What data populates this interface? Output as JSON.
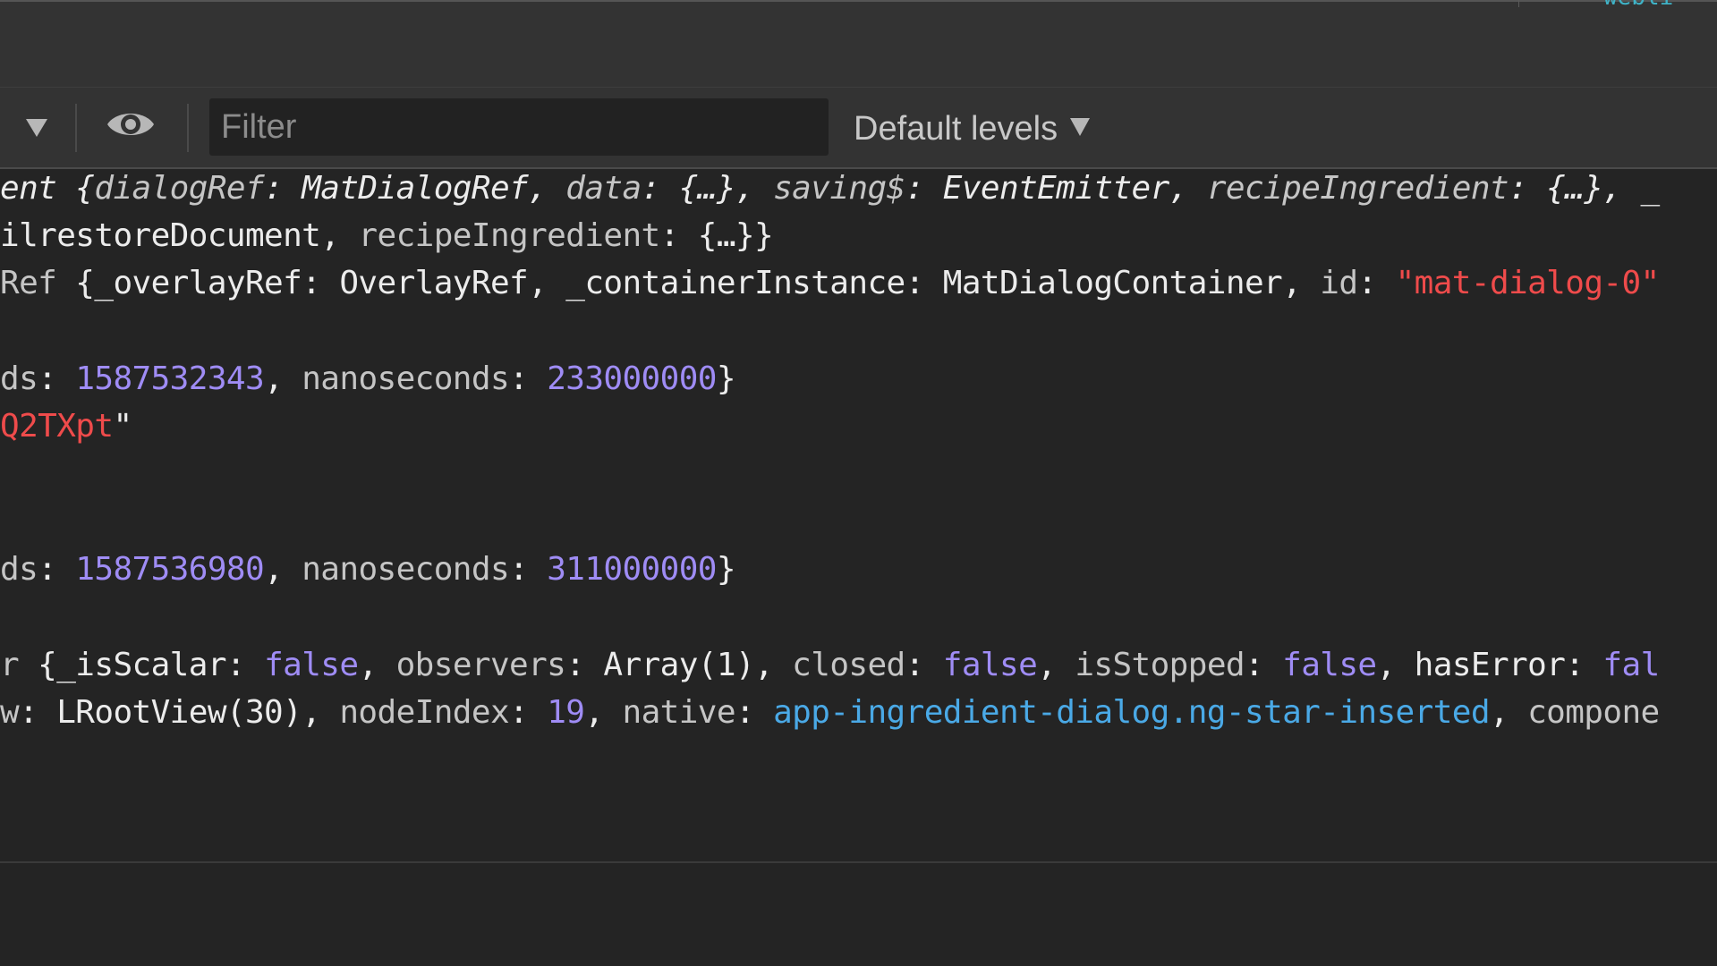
{
  "top_bar": {
    "corner_text": "webli"
  },
  "toolbar": {
    "filter_placeholder": "Filter",
    "levels_label": "Default levels"
  },
  "icons": {
    "dropdown": "triangle-down-icon",
    "eye": "eye-icon",
    "levels_dropdown": "chevron-down-icon"
  },
  "colors": {
    "background": "#242424",
    "toolbar": "#333333",
    "number": "#9f8cf5",
    "string": "#ef4b4b",
    "node": "#4aa9e6",
    "key": "#c5c5c5"
  },
  "console": {
    "line1": {
      "prefix": "ent {",
      "k1": "dialogRef",
      "v1": "MatDialogRef",
      "k2": "data",
      "v2": "{…}",
      "k3": "saving$",
      "v3": "EventEmitter",
      "k4": "recipeIngredient",
      "v4": "{…}",
      "tail": ", _"
    },
    "line2": {
      "prefix": "ilrestoreDocument",
      "k1": "recipeIngredient",
      "v1": "{…}",
      "suffix": "}"
    },
    "line3": {
      "prefix": "Ref",
      "k1": "_overlayRef",
      "v1": "OverlayRef",
      "k2": "_containerInstance",
      "v2": "MatDialogContainer",
      "k3": "id",
      "v3": "\"mat-dialog-0\""
    },
    "line4": {
      "k1": "ds",
      "v1": "1587532343",
      "k2": "nanoseconds",
      "v2": "233000000"
    },
    "line5": {
      "str": "Q2TXpt",
      "quote": "\""
    },
    "line6": {
      "k1": "ds",
      "v1": "1587536980",
      "k2": "nanoseconds",
      "v2": "311000000"
    },
    "line7": {
      "prefix": "r",
      "k1": "_isScalar",
      "v1": "false",
      "k2": "observers",
      "v2": "Array(1)",
      "k3": "closed",
      "v3": "false",
      "k4": "isStopped",
      "v4": "false",
      "k5": "hasError",
      "v5": "fal"
    },
    "line8": {
      "prefix": "w",
      "v0": "LRootView(30)",
      "k1": "nodeIndex",
      "v1": "19",
      "k2": "native",
      "v2": "app-ingredient-dialog.ng-star-inserted",
      "k3": "compone"
    }
  }
}
